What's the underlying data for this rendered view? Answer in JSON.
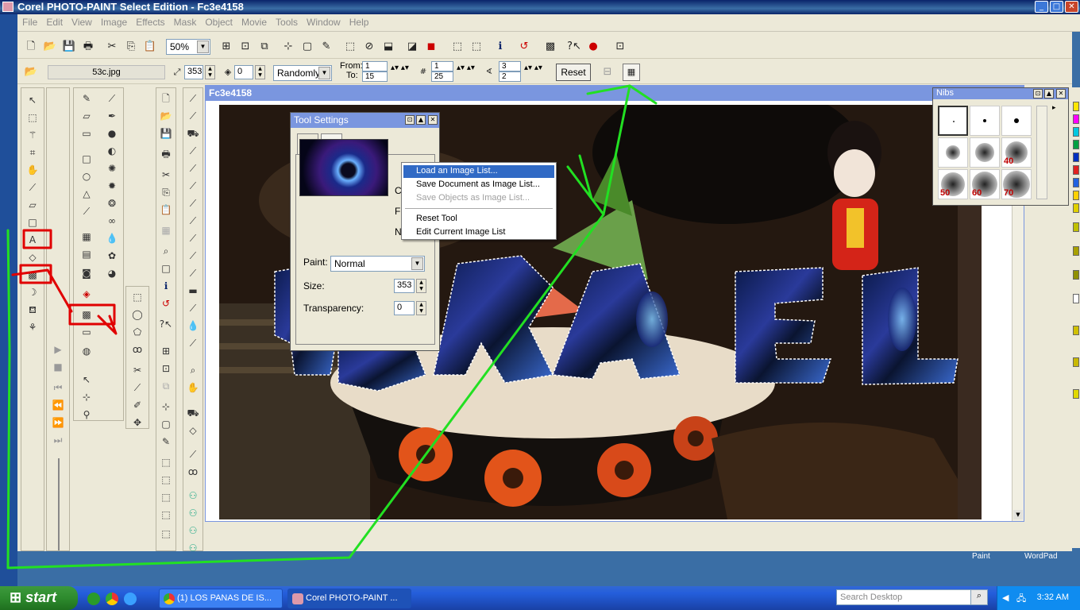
{
  "window": {
    "title": "Corel PHOTO-PAINT Select Edition - Fc3e4158"
  },
  "menu": [
    "File",
    "Edit",
    "View",
    "Image",
    "Effects",
    "Mask",
    "Object",
    "Movie",
    "Tools",
    "Window",
    "Help"
  ],
  "toolbar": {
    "zoom": "50%"
  },
  "property_bar": {
    "filename": "53c.jpg",
    "size": "353",
    "rotation": "0",
    "order": "Randomly",
    "from_label": "From:",
    "to_label": "To:",
    "from_value": "1",
    "to_value": "15",
    "count_a_from": "1",
    "count_a_to": "25",
    "count_b_from": "3",
    "count_b_to": "2",
    "reset_label": "Reset"
  },
  "document": {
    "title": "Fc3e4158"
  },
  "tool_settings": {
    "title": "Tool Settings",
    "paint_label": "Paint:",
    "paint_value": "Normal",
    "size_label": "Size:",
    "size_value": "353",
    "transparency_label": "Transparency:",
    "transparency_value": "0",
    "clipped_1": "C",
    "clipped_2": "F",
    "clipped_3": "N"
  },
  "context_menu": [
    {
      "label": "Load an Image List...",
      "state": "highlighted"
    },
    {
      "label": "Save Document as Image List...",
      "state": "enabled"
    },
    {
      "label": "Save Objects as Image List...",
      "state": "disabled"
    },
    {
      "label": "Reset Tool",
      "state": "enabled"
    },
    {
      "label": "Edit Current Image List",
      "state": "enabled"
    }
  ],
  "nibs": {
    "title": "Nibs",
    "sizes": [
      "40",
      "50",
      "60",
      "70"
    ]
  },
  "desktop": {
    "icon_1": "Paint",
    "icon_2": "WordPad"
  },
  "taskbar": {
    "start": "start",
    "tasks": [
      "(1) LOS PANAS DE IS...",
      "Corel PHOTO-PAINT ..."
    ],
    "search_placeholder": "Search Desktop",
    "clock": "3:32 AM"
  },
  "colors": {
    "annotation_green": "#22e022",
    "annotation_red": "#e00000",
    "highlight": "#316ac5",
    "titlebar": "#0a246a"
  }
}
